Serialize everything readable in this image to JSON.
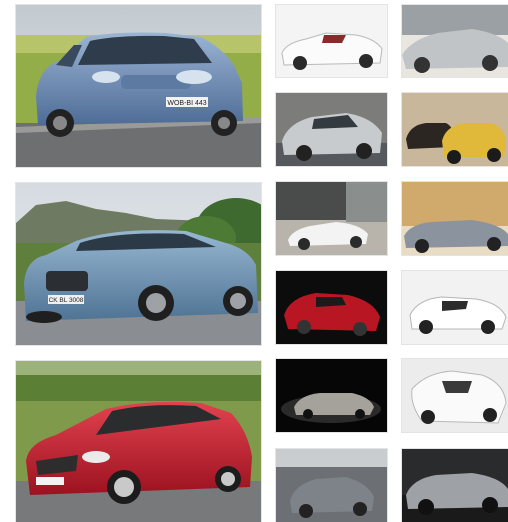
{
  "gallery": {
    "large_images": [
      {
        "subject": "blue-hatchback-on-road",
        "plate": "WOB-BI 443"
      },
      {
        "subject": "blue-sportback-on-road",
        "plate": "CK BL 3008"
      },
      {
        "subject": "red-hatchback-on-road",
        "plate": ""
      }
    ],
    "thumbnails": [
      {
        "subject": "white-convertible-coupe"
      },
      {
        "subject": "silver-roadster-bright-background"
      },
      {
        "subject": "silver-sports-coupe-gray-background"
      },
      {
        "subject": "yellow-and-dark-mini-convertibles"
      },
      {
        "subject": "white-convertible-in-showroom"
      },
      {
        "subject": "gray-convertible-sepia-background"
      },
      {
        "subject": "red-convertible-black-background"
      },
      {
        "subject": "white-roadster-white-background"
      },
      {
        "subject": "silver-coupe-spotlit-black-background"
      },
      {
        "subject": "white-supercar-white-background"
      },
      {
        "subject": "gray-sports-car-on-track"
      },
      {
        "subject": "gray-coupe-dark-background"
      }
    ]
  },
  "colors": {
    "blue_car": "#6f8fb8",
    "sportback_car": "#6d93b4",
    "red_car": "#c51c2c",
    "grass": "#8fa94a",
    "sky": "#c8d3dc",
    "road": "#6a6a6a"
  }
}
